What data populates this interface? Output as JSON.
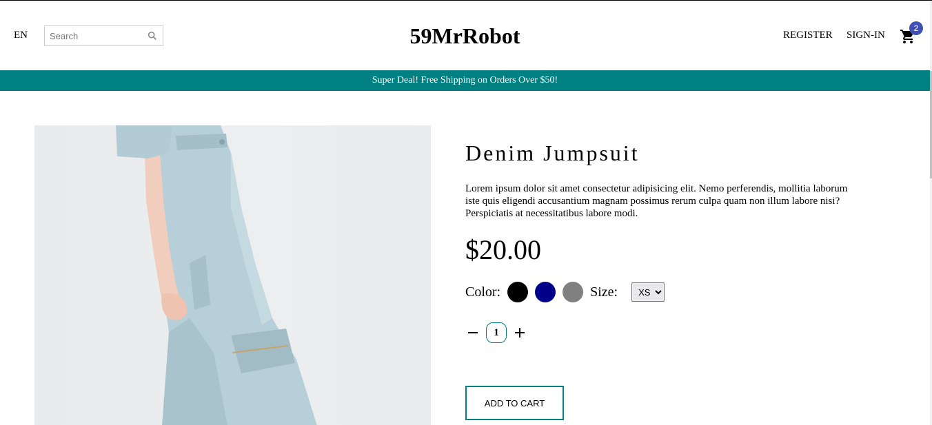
{
  "navbar": {
    "language": "EN",
    "search_placeholder": "Search",
    "logo": "59MrRobot",
    "register_label": "REGISTER",
    "signin_label": "SIGN-IN",
    "cart_count": "2"
  },
  "announcement": "Super Deal! Free Shipping on Orders Over $50!",
  "product": {
    "title": "Denim Jumpsuit",
    "description": "Lorem ipsum dolor sit amet consectetur adipisicing elit. Nemo perferendis, mollitia laborum iste quis eligendi accusantium magnam possimus rerum culpa quam non illum labore nisi? Perspiciatis at necessitatibus labore modi.",
    "price": "$20.00",
    "color_label": "Color:",
    "colors": [
      "#000000",
      "#00008b",
      "#808080"
    ],
    "size_label": "Size:",
    "size_selected": "XS",
    "quantity": "1",
    "add_to_cart_label": "ADD TO CART"
  },
  "colors": {
    "accent": "#008080",
    "badge": "#3f51b5"
  },
  "icons": {
    "search": "search-icon",
    "cart": "shopping-cart-icon",
    "minus": "minus-icon",
    "plus": "plus-icon",
    "dropdown": "chevron-down-icon"
  }
}
